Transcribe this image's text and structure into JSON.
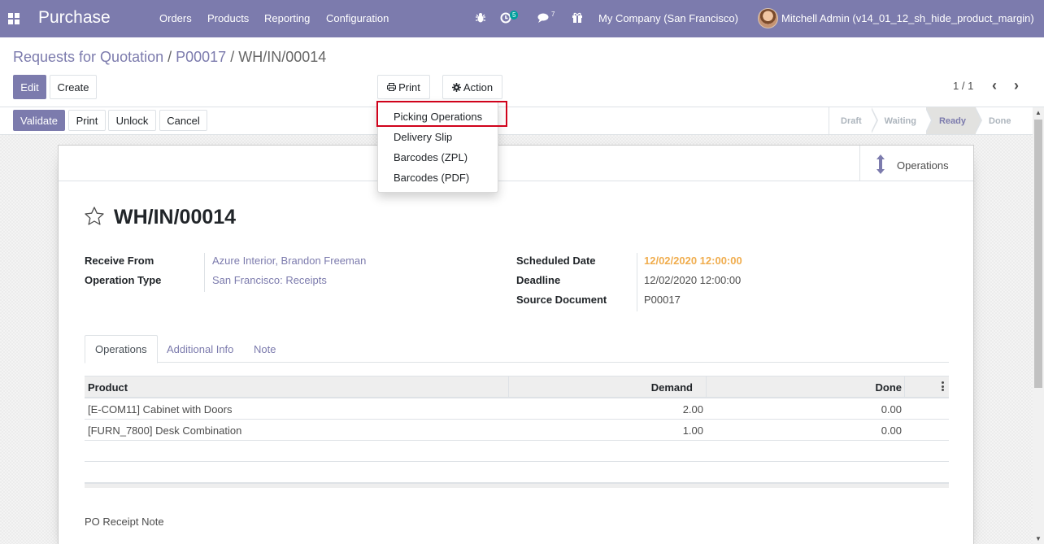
{
  "navbar": {
    "app_name": "Purchase",
    "menu": [
      "Orders",
      "Products",
      "Reporting",
      "Configuration"
    ],
    "activity_count": "5",
    "message_count": "7",
    "company": "My Company (San Francisco)",
    "user": "Mitchell Admin (v14_01_12_sh_hide_product_margin)",
    "colors": {
      "bar": "#7c7bad",
      "badge": "#00a09d"
    }
  },
  "breadcrumb": {
    "first": "Requests for Quotation",
    "second": "P00017",
    "current": "WH/IN/00014",
    "separator": "/"
  },
  "control": {
    "edit": "Edit",
    "create": "Create",
    "print": "Print",
    "action": "Action",
    "pager": "1 / 1"
  },
  "print_menu": {
    "items": [
      "Picking Operations",
      "Delivery Slip",
      "Barcodes (ZPL)",
      "Barcodes (PDF)"
    ],
    "highlighted": "Picking Operations"
  },
  "header_buttons": {
    "validate": "Validate",
    "print": "Print",
    "unlock": "Unlock",
    "cancel": "Cancel"
  },
  "status": {
    "stages": [
      "Draft",
      "Waiting",
      "Ready",
      "Done"
    ],
    "current": "Ready"
  },
  "sheet": {
    "smart_button": "Operations",
    "title": "WH/IN/00014",
    "left_fields": [
      {
        "label": "Receive From",
        "value": "Azure Interior, Brandon Freeman"
      },
      {
        "label": "Operation Type",
        "value": "San Francisco: Receipts"
      }
    ],
    "right_fields": [
      {
        "label": "Scheduled Date",
        "value": "12/02/2020 12:00:00"
      },
      {
        "label": "Deadline",
        "value": "12/02/2020 12:00:00"
      },
      {
        "label": "Source Document",
        "value": "P00017"
      }
    ],
    "tabs": [
      "Operations",
      "Additional Info",
      "Note"
    ],
    "active_tab": "Operations",
    "table": {
      "headers": [
        "Product",
        "Demand",
        "Done"
      ],
      "rows": [
        {
          "product": "[E-COM11] Cabinet with Doors",
          "demand": "2.00",
          "done": "0.00"
        },
        {
          "product": "[FURN_7800] Desk Combination",
          "demand": "1.00",
          "done": "0.00"
        }
      ]
    },
    "note": "PO Receipt Note"
  }
}
